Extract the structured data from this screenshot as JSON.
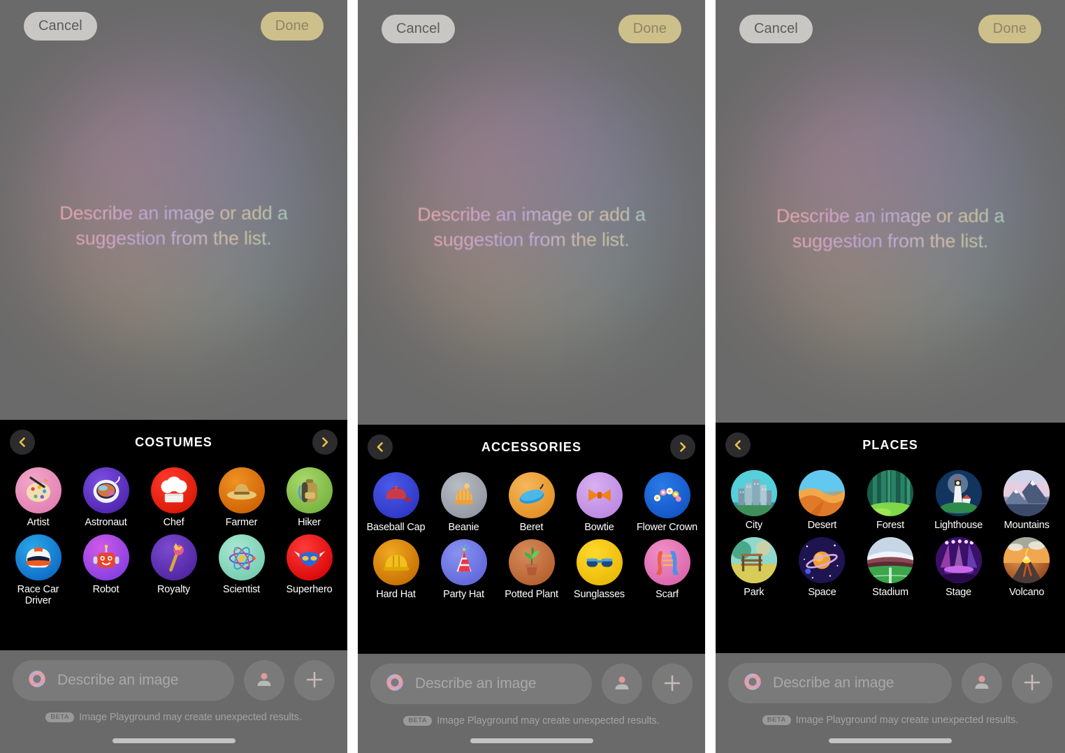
{
  "app": {
    "name": "Image Playground",
    "hero_text_line1": "Describe an image or add a",
    "hero_text_line2": "suggestion from the list.",
    "hero_text": "Describe an image or add a suggestion from the list."
  },
  "topbar": {
    "cancel_label": "Cancel",
    "done_label": "Done",
    "cancel_bg": "#c9c7c4",
    "done_bg": "#cec08b"
  },
  "composer": {
    "placeholder": "Describe an image",
    "beta_badge": "BETA",
    "disclaimer": "Image Playground may create unexpected results.",
    "person_button_label": "Add person",
    "plus_button_label": "Add"
  },
  "nav": {
    "prev_label": "Previous category",
    "next_label": "Next category",
    "chevron_color": "#e8c34a",
    "button_bg": "#2c2c2e"
  },
  "panels": [
    {
      "id": "costumes",
      "category_title": "COSTUMES",
      "has_prev": true,
      "has_next": true,
      "items": [
        {
          "label": "Artist",
          "bg1": "#f2a8c8",
          "bg2": "#e07ab0",
          "icon": "palette-icon"
        },
        {
          "label": "Astronaut",
          "bg1": "#7a4fe0",
          "bg2": "#4a1fa8",
          "icon": "astronaut-helmet-icon"
        },
        {
          "label": "Chef",
          "bg1": "#ff3a2e",
          "bg2": "#d41400",
          "icon": "chef-hat-icon"
        },
        {
          "label": "Farmer",
          "bg1": "#f09222",
          "bg2": "#c85c00",
          "icon": "farmer-hat-icon"
        },
        {
          "label": "Hiker",
          "bg1": "#a8d86a",
          "bg2": "#6fae38",
          "icon": "backpack-icon"
        },
        {
          "label": "Race Car Driver",
          "bg1": "#2aa7e8",
          "bg2": "#0a63c4",
          "icon": "racing-helmet-icon"
        },
        {
          "label": "Robot",
          "bg1": "#d05ae8",
          "bg2": "#7a3ae0",
          "icon": "robot-icon"
        },
        {
          "label": "Royalty",
          "bg1": "#7a4ad0",
          "bg2": "#4a1f9a",
          "icon": "scepter-icon"
        },
        {
          "label": "Scientist",
          "bg1": "#a8e8cf",
          "bg2": "#6fc8ae",
          "icon": "atom-icon"
        },
        {
          "label": "Superhero",
          "bg1": "#ff3a3a",
          "bg2": "#d40000",
          "icon": "superhero-mask-icon"
        }
      ]
    },
    {
      "id": "accessories",
      "category_title": "ACCESSORIES",
      "has_prev": true,
      "has_next": true,
      "items": [
        {
          "label": "Baseball Cap",
          "bg1": "#4a5ae8",
          "bg2": "#2a32c0",
          "icon": "baseball-cap-icon"
        },
        {
          "label": "Beanie",
          "bg1": "#b8bcc4",
          "bg2": "#8d929c",
          "icon": "beanie-icon"
        },
        {
          "label": "Beret",
          "bg1": "#f5b85c",
          "bg2": "#e08a1a",
          "icon": "beret-icon"
        },
        {
          "label": "Bowtie",
          "bg1": "#d8b0f0",
          "bg2": "#b882e0",
          "icon": "bowtie-icon"
        },
        {
          "label": "Flower Crown",
          "bg1": "#2a7ae8",
          "bg2": "#1050c0",
          "icon": "flower-crown-icon"
        },
        {
          "label": "Hard Hat",
          "bg1": "#f0a820",
          "bg2": "#c06800",
          "icon": "hard-hat-icon"
        },
        {
          "label": "Party Hat",
          "bg1": "#8a92f0",
          "bg2": "#5a62d8",
          "icon": "party-hat-icon"
        },
        {
          "label": "Potted Plant",
          "bg1": "#d88a5a",
          "bg2": "#b05a28",
          "icon": "potted-plant-icon"
        },
        {
          "label": "Sunglasses",
          "bg1": "#ffd92e",
          "bg2": "#e8b400",
          "icon": "sunglasses-icon"
        },
        {
          "label": "Scarf",
          "bg1": "#f090c8",
          "bg2": "#d860a8",
          "icon": "scarf-icon"
        }
      ]
    },
    {
      "id": "places",
      "category_title": "PLACES",
      "has_prev": true,
      "has_next": false,
      "items": [
        {
          "label": "City",
          "bg1": "#4ecfd8",
          "bg2": "#1a7a96",
          "icon": "city-skyline-icon"
        },
        {
          "label": "Desert",
          "bg1": "#62c8f0",
          "bg2": "#e08a28",
          "icon": "desert-dune-icon"
        },
        {
          "label": "Forest",
          "bg1": "#2e8a7a",
          "bg2": "#154a40",
          "icon": "forest-icon"
        },
        {
          "label": "Lighthouse",
          "bg1": "#123a6a",
          "bg2": "#0a1e3a",
          "icon": "lighthouse-icon"
        },
        {
          "label": "Mountains",
          "bg1": "#d8c8e0",
          "bg2": "#5a6a8a",
          "icon": "mountains-icon"
        },
        {
          "label": "Park",
          "bg1": "#8ad0c8",
          "bg2": "#d8c858",
          "icon": "park-bench-icon"
        },
        {
          "label": "Space",
          "bg1": "#3a2a8a",
          "bg2": "#120a3a",
          "icon": "planet-icon"
        },
        {
          "label": "Stadium",
          "bg1": "#c8d8e8",
          "bg2": "#2e8a3a",
          "icon": "stadium-icon"
        },
        {
          "label": "Stage",
          "bg1": "#8a2ad8",
          "bg2": "#3a0a6a",
          "icon": "stage-lights-icon"
        },
        {
          "label": "Volcano",
          "bg1": "#f0a850",
          "bg2": "#8a3a1a",
          "icon": "volcano-icon"
        }
      ]
    }
  ]
}
